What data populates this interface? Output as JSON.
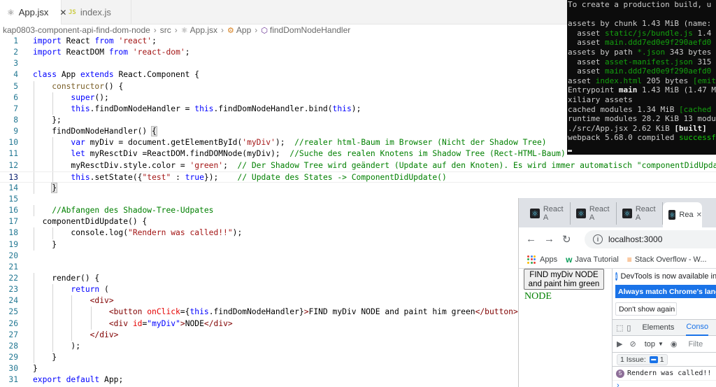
{
  "editor": {
    "tabs": [
      {
        "label": "App.jsx",
        "close": "✕"
      },
      {
        "label": "index.js",
        "icon_text": "JS"
      }
    ],
    "breadcrumb": [
      "kap0803-component-api-find-dom-node",
      "src",
      "App.jsx",
      "App",
      "findDomNodeHandler"
    ],
    "current_line": 13,
    "lines": [
      [
        [
          "kw",
          "import"
        ],
        [
          "p",
          " React "
        ],
        [
          "kw",
          "from"
        ],
        [
          "p",
          " "
        ],
        [
          "str",
          "'react'"
        ],
        [
          "p",
          ";"
        ]
      ],
      [
        [
          "kw",
          "import"
        ],
        [
          "p",
          " ReactDOM "
        ],
        [
          "kw",
          "from"
        ],
        [
          "p",
          " "
        ],
        [
          "str",
          "'react-dom'"
        ],
        [
          "p",
          ";"
        ]
      ],
      [],
      [
        [
          "kw",
          "class"
        ],
        [
          "p",
          " App "
        ],
        [
          "kw",
          "extends"
        ],
        [
          "p",
          " React.Component {"
        ]
      ],
      [
        [
          "p",
          "    "
        ],
        [
          "fn",
          "constructor"
        ],
        [
          "p",
          "() {"
        ]
      ],
      [
        [
          "p",
          "        "
        ],
        [
          "kw",
          "super"
        ],
        [
          "p",
          "();"
        ]
      ],
      [
        [
          "p",
          "        "
        ],
        [
          "kw",
          "this"
        ],
        [
          "p",
          ".findDomNodeHandler = "
        ],
        [
          "kw",
          "this"
        ],
        [
          "p",
          ".findDomNodeHandler.bind("
        ],
        [
          "kw",
          "this"
        ],
        [
          "p",
          ");"
        ]
      ],
      [
        [
          "p",
          "    };"
        ]
      ],
      [
        [
          "p",
          "    findDomNodeHandler() "
        ],
        [
          "brk",
          "{"
        ]
      ],
      [
        [
          "p",
          "        "
        ],
        [
          "kw",
          "var"
        ],
        [
          "p",
          " myDiv = document.getElementById("
        ],
        [
          "str",
          "'myDiv'"
        ],
        [
          "p",
          ");  "
        ],
        [
          "com",
          "//realer html-Baum im Browser (Nicht der Shadow Tree)"
        ]
      ],
      [
        [
          "p",
          "        "
        ],
        [
          "kw",
          "let"
        ],
        [
          "p",
          " myResctDiv =ReactDOM.findDOMNode(myDiv);  "
        ],
        [
          "com",
          "//Suche des realen Knotens im Shadow Tree (Rect-HTML-Baum)"
        ]
      ],
      [
        [
          "p",
          "        myResctDiv.style.color = "
        ],
        [
          "str",
          "'green'"
        ],
        [
          "p",
          ";  "
        ],
        [
          "com",
          "// Der Shadow Tree wird geändert (Update auf den Knoten). Es wird immer automatisch \"componentDidUpdate\" au"
        ]
      ],
      [
        [
          "p",
          "        "
        ],
        [
          "kw",
          "this"
        ],
        [
          "p",
          ".setState({"
        ],
        [
          "str",
          "\"test\""
        ],
        [
          "p",
          " : "
        ],
        [
          "kw",
          "true"
        ],
        [
          "p",
          "});    "
        ],
        [
          "com",
          "// Update des States -> ComponentDidUpdate()"
        ]
      ],
      [
        [
          "p",
          "    "
        ],
        [
          "brk",
          "}"
        ]
      ],
      [],
      [
        [
          "p",
          "    "
        ],
        [
          "com",
          "//Abfangen des Shadow-Tree-Udpates"
        ]
      ],
      [
        [
          "p",
          "  componentDidUpdate() {"
        ]
      ],
      [
        [
          "p",
          "        console.log("
        ],
        [
          "str",
          "\"Rendern was called!!\""
        ],
        [
          "p",
          ");"
        ]
      ],
      [
        [
          "p",
          "    }"
        ]
      ],
      [],
      [],
      [
        [
          "p",
          "    render() {"
        ]
      ],
      [
        [
          "p",
          "        "
        ],
        [
          "kw",
          "return"
        ],
        [
          "p",
          " ("
        ]
      ],
      [
        [
          "p",
          "            "
        ],
        [
          "jsx",
          "<div>"
        ]
      ],
      [
        [
          "p",
          "                "
        ],
        [
          "jsx",
          "<button"
        ],
        [
          "p",
          " "
        ],
        [
          "attr",
          "onClick"
        ],
        [
          "p",
          "={"
        ],
        [
          "kw",
          "this"
        ],
        [
          "p",
          ".findDomNodeHandler}"
        ],
        [
          "jsx",
          ">"
        ],
        [
          "p",
          "FIND myDiv NODE and paint him green"
        ],
        [
          "jsx",
          "</button>"
        ]
      ],
      [
        [
          "p",
          "                "
        ],
        [
          "jsx",
          "<div"
        ],
        [
          "p",
          " "
        ],
        [
          "attr",
          "id"
        ],
        [
          "p",
          "="
        ],
        [
          "kw",
          "\"myDiv\""
        ],
        [
          "jsx",
          ">"
        ],
        [
          "p",
          "NODE"
        ],
        [
          "jsx",
          "</div>"
        ]
      ],
      [
        [
          "p",
          "            "
        ],
        [
          "jsx",
          "</div>"
        ]
      ],
      [
        [
          "p",
          "        );"
        ]
      ],
      [
        [
          "p",
          "    }"
        ]
      ],
      [
        [
          "p",
          "}"
        ]
      ],
      [
        [
          "kw",
          "export"
        ],
        [
          "p",
          " "
        ],
        [
          "kw",
          "default"
        ],
        [
          "p",
          " App;"
        ]
      ]
    ]
  },
  "terminal": {
    "lines": [
      [
        [
          "w",
          "To create a production build, u"
        ]
      ],
      [
        [
          "w",
          ""
        ]
      ],
      [
        [
          "w",
          "assets by chunk 1.43 MiB (name:"
        ]
      ],
      [
        [
          "w",
          "  asset "
        ],
        [
          "g",
          "static/js/bundle.js"
        ],
        [
          "w",
          " 1.4"
        ]
      ],
      [
        [
          "w",
          "  asset "
        ],
        [
          "g",
          "main.ddd7ed0e9f290aefd0"
        ]
      ],
      [
        [
          "w",
          "assets by path "
        ],
        [
          "g",
          "*.json"
        ],
        [
          "w",
          " 343 bytes"
        ]
      ],
      [
        [
          "w",
          "  asset "
        ],
        [
          "g",
          "asset-manifest.json"
        ],
        [
          "w",
          " 315"
        ]
      ],
      [
        [
          "w",
          "  asset "
        ],
        [
          "g",
          "main.ddd7ed0e9f290aefd0"
        ]
      ],
      [
        [
          "w",
          "asset "
        ],
        [
          "g",
          "index.html"
        ],
        [
          "w",
          " 205 bytes "
        ],
        [
          "g",
          "[emit"
        ]
      ],
      [
        [
          "w",
          "Entrypoint "
        ],
        [
          "b",
          "main"
        ],
        [
          "w",
          " 1.43 MiB (1.47 M"
        ]
      ],
      [
        [
          "w",
          "xiliary assets"
        ]
      ],
      [
        [
          "w",
          "cached modules 1.34 MiB "
        ],
        [
          "g",
          "[cached"
        ]
      ],
      [
        [
          "w",
          "runtime modules 28.2 KiB 13 modu"
        ]
      ],
      [
        [
          "w",
          "./src/App.jsx 2.62 KiB "
        ],
        [
          "b",
          "[built]"
        ]
      ],
      [
        [
          "w",
          "webpack 5.68.0 compiled "
        ],
        [
          "bg",
          "successf"
        ]
      ]
    ]
  },
  "browser": {
    "tabs": [
      {
        "label": "React A"
      },
      {
        "label": "React A"
      },
      {
        "label": "React A"
      },
      {
        "label": "Rea",
        "close": "✕"
      }
    ],
    "url": "localhost:3000",
    "bookmarks": [
      "Apps",
      "Java Tutorial",
      "Stack Overflow - W..."
    ],
    "page": {
      "button_label": "FIND myDiv NODE and paint him green",
      "node_text": "NODE"
    },
    "devtools": {
      "notice": "DevTools is now available in G",
      "match_button": "Always match Chrome's langua",
      "dont_show": "Don't show again",
      "panels": [
        "Elements",
        "Conso"
      ],
      "context": "top",
      "filter": "Filte",
      "issues_label": "1 Issue:",
      "issues_count": "1",
      "log_badge": "5",
      "log_message": "Rendern was called!!",
      "prompt": "›"
    }
  },
  "colors": {
    "keyword": "#0000ff",
    "string": "#a31515",
    "comment": "#008000",
    "jsx_tag": "#800000",
    "jsx_attr": "#e50000",
    "node_green": "#008000",
    "chrome_blue": "#1a73e8"
  }
}
